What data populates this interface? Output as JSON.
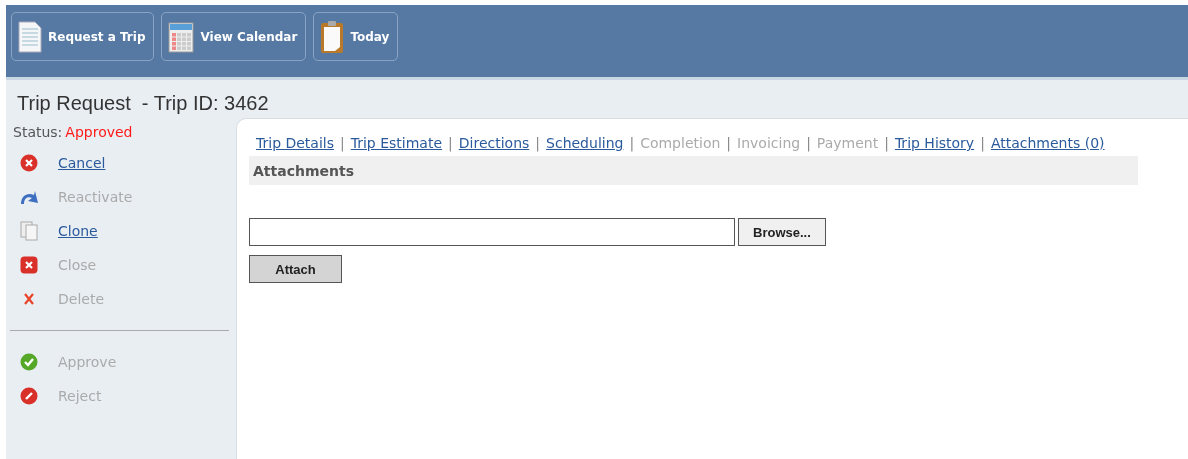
{
  "toolbar": [
    {
      "label": "Request a Trip",
      "kind": "document"
    },
    {
      "label": "View Calendar",
      "kind": "calendar"
    },
    {
      "label": "Today",
      "kind": "clipboard"
    }
  ],
  "title": "Trip Request  - Trip ID: 3462",
  "status": {
    "label": "Status:",
    "value": "Approved"
  },
  "action_groups": [
    [
      {
        "label": "Cancel",
        "kind": "cancel",
        "disabled": false
      },
      {
        "label": "Reactivate",
        "kind": "reactivate",
        "disabled": true
      },
      {
        "label": "Clone",
        "kind": "clone",
        "disabled": false
      },
      {
        "label": "Close",
        "kind": "close",
        "disabled": true
      },
      {
        "label": "Delete",
        "kind": "delete",
        "disabled": true
      }
    ],
    [
      {
        "label": "Approve",
        "kind": "approve",
        "disabled": true
      },
      {
        "label": "Reject",
        "kind": "reject",
        "disabled": true
      }
    ]
  ],
  "tab_separator": "|",
  "tabs": [
    {
      "label": "Trip Details",
      "disabled": false
    },
    {
      "label": "Trip Estimate",
      "disabled": false
    },
    {
      "label": "Directions",
      "disabled": false
    },
    {
      "label": "Scheduling",
      "disabled": false
    },
    {
      "label": "Completion",
      "disabled": true
    },
    {
      "label": "Invoicing",
      "disabled": true
    },
    {
      "label": "Payment",
      "disabled": true
    },
    {
      "label": "Trip History",
      "disabled": false
    },
    {
      "label": "Attachments (0)",
      "disabled": false
    }
  ],
  "section_title": "Attachments",
  "browse_button": "Browse...",
  "attach_button": "Attach"
}
